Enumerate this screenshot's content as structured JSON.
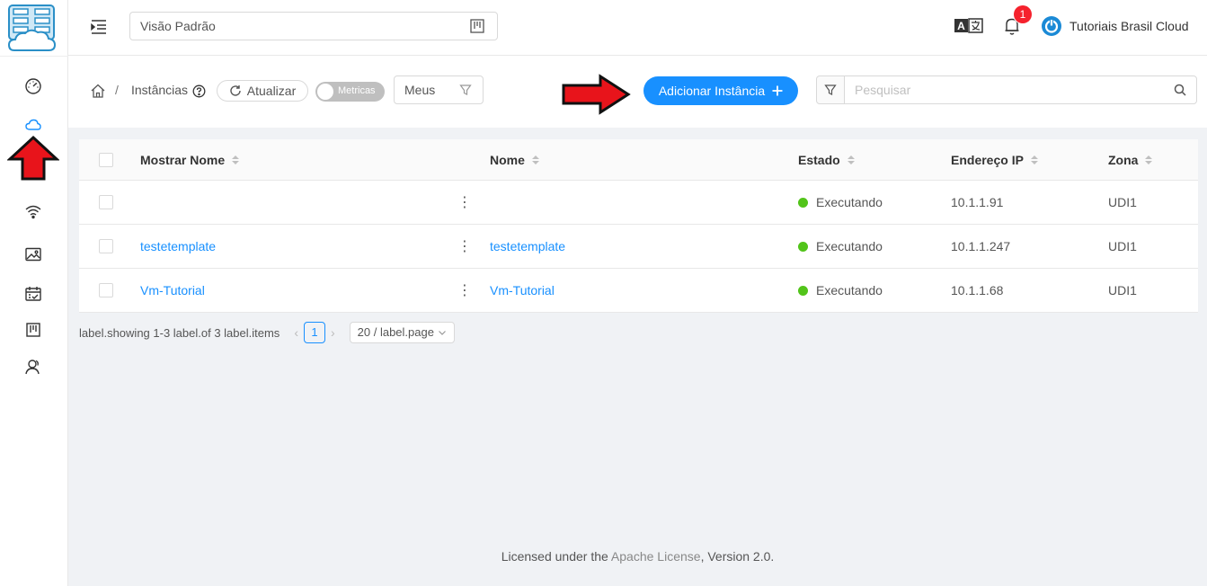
{
  "header": {
    "project_value": "Visão Padrão",
    "notification_count": "1",
    "user_name": "Tutoriais Brasil Cloud"
  },
  "toolbar": {
    "breadcrumb_current": "Instâncias",
    "refresh_label": "Atualizar",
    "metrics_label": "Metricas",
    "filter_value": "Meus",
    "add_label": "Adicionar Instância",
    "search_placeholder": "Pesquisar"
  },
  "table": {
    "columns": {
      "display_name": "Mostrar Nome",
      "name": "Nome",
      "state": "Estado",
      "ip": "Endereço IP",
      "zone": "Zona"
    },
    "rows": [
      {
        "display_name": "",
        "name": "",
        "state": "Executando",
        "ip": "10.1.1.91",
        "zone": "UDI1"
      },
      {
        "display_name": "testetemplate",
        "name": "testetemplate",
        "state": "Executando",
        "ip": "10.1.1.247",
        "zone": "UDI1"
      },
      {
        "display_name": "Vm-Tutorial",
        "name": "Vm-Tutorial",
        "state": "Executando",
        "ip": "10.1.1.68",
        "zone": "UDI1"
      }
    ]
  },
  "pagination": {
    "summary": "label.showing 1-3 label.of 3 label.items",
    "current_page": "1",
    "page_size": "20 / label.page"
  },
  "footer": {
    "prefix": "Licensed under the ",
    "link": "Apache License",
    "suffix": ", Version 2.0."
  },
  "colors": {
    "primary": "#1890ff",
    "running": "#52c41a",
    "badge": "#f5222d",
    "annotation_arrow": "#e8141b"
  }
}
